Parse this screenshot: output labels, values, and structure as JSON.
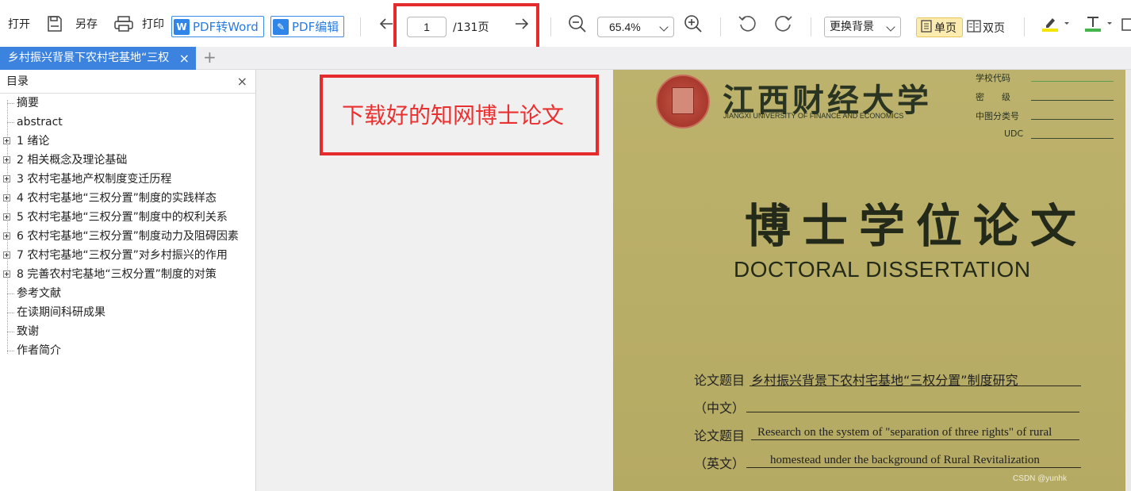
{
  "toolbar": {
    "open": "打开",
    "save_as": "另存",
    "print": "打印",
    "pdf_to_word": "PDF转Word",
    "pdf_edit": "PDF编辑",
    "current_page": "1",
    "total_pages": "/131页",
    "zoom": "65.4%",
    "background": "更换背景",
    "single_page": "单页",
    "double_page": "双页"
  },
  "tab": {
    "title": "乡村振兴背景下农村宅基地“三权",
    "close": "×",
    "add": "+"
  },
  "sidebar": {
    "title": "目录",
    "close": "×",
    "items": [
      {
        "label": "摘要",
        "expandable": false
      },
      {
        "label": "abstract",
        "expandable": false
      },
      {
        "label": "1 绪论",
        "expandable": true
      },
      {
        "label": "2 相关概念及理论基础",
        "expandable": true
      },
      {
        "label": "3 农村宅基地产权制度变迁历程",
        "expandable": true
      },
      {
        "label": "4 农村宅基地“三权分置”制度的实践样态",
        "expandable": true
      },
      {
        "label": "5 农村宅基地“三权分置”制度中的权利关系",
        "expandable": true
      },
      {
        "label": "6 农村宅基地“三权分置”制度动力及阻碍因素",
        "expandable": true
      },
      {
        "label": "7 农村宅基地“三权分置”对乡村振兴的作用",
        "expandable": true
      },
      {
        "label": "8 完善农村宅基地“三权分置”制度的对策",
        "expandable": true
      },
      {
        "label": "参考文献",
        "expandable": false
      },
      {
        "label": "在读期间科研成果",
        "expandable": false
      },
      {
        "label": "致谢",
        "expandable": false
      },
      {
        "label": "作者简介",
        "expandable": false
      }
    ]
  },
  "annotation": {
    "text": "下载好的知网博士论文",
    "color": "#e52b2b"
  },
  "document": {
    "university_cn": "江西财经大学",
    "university_en": "JIANGXI UNIVERSITY OF FINANCE AND ECONOMICS",
    "meta_labels": [
      "学校代码",
      "密　　级",
      "中图分类号",
      "UDC"
    ],
    "title_cn": "博士学位论文",
    "title_en": "DOCTORAL DISSERTATION",
    "thesis_title_label": "论文题目",
    "thesis_title_cn": "乡村振兴背景下农村宅基地“三权分置”制度研究",
    "cn_label": "（中文）",
    "thesis_title_en_label": "论文题目",
    "thesis_title_en_1": "Research on the system of \"separation of three rights\" of rural",
    "en_label": "（英文）",
    "thesis_title_en_2": "homestead under the background of Rural Revitalization",
    "watermark": "CSDN @yunhk"
  },
  "colors": {
    "accent": "#3c83e0",
    "highlight_box": "#e52b2b",
    "page_bg": "#bcb16a"
  }
}
